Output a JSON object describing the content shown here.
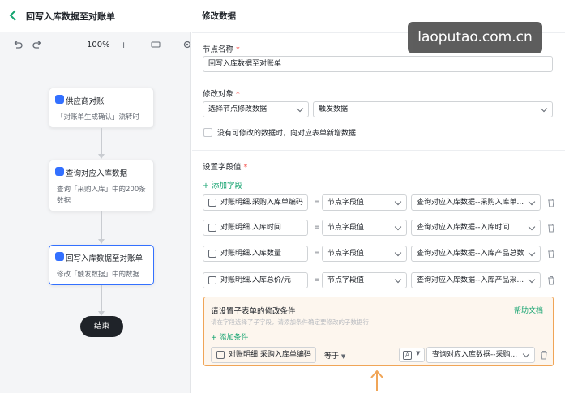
{
  "header": {
    "title": "回写入库数据至对账单"
  },
  "toolbar": {
    "zoom": "100%"
  },
  "flow": {
    "nodes": [
      {
        "title": "供应商对账",
        "desc": "「对账单生成确认」流转时"
      },
      {
        "title": "查询对应入库数据",
        "desc": "查询「采购入库」中的200条数据"
      },
      {
        "title": "回写入库数据至对账单",
        "desc": "修改「触发数据」中的数据"
      }
    ],
    "end": "结束"
  },
  "panel": {
    "title": "修改数据",
    "node_name_label": "节点名称",
    "node_name_value": "回写入库数据至对账单",
    "target_label": "修改对象",
    "target_select1": "选择节点修改数据",
    "target_select2": "触发数据",
    "checkbox_label": "没有可修改的数据时，向对应表单新增数据",
    "fields_label": "设置字段值",
    "add_field": "+ 添加字段",
    "rows": [
      {
        "field": "对账明细.采购入库单编码",
        "op": "=",
        "mode": "节点字段值",
        "value": "查询对应入库数据--采购入库单..."
      },
      {
        "field": "对账明细.入库时间",
        "op": "=",
        "mode": "节点字段值",
        "value": "查询对应入库数据--入库时间"
      },
      {
        "field": "对账明细.入库数量",
        "op": "=",
        "mode": "节点字段值",
        "value": "查询对应入库数据--入库产品总数"
      },
      {
        "field": "对账明细.入库总价/元",
        "op": "=",
        "mode": "节点字段值",
        "value": "查询对应入库数据--入库产品采..."
      }
    ],
    "condition": {
      "title": "请设置子表单的修改条件",
      "help": "帮助文档",
      "hint": "请在字段选择了子字段，请添加条件确定要修改的子数据行",
      "add": "+ 添加条件",
      "field": "对账明细.采购入库单编码",
      "op": "等于",
      "type_badge": "A",
      "value": "查询对应入库数据--采购..."
    }
  },
  "watermark": "laoputao.com.cn",
  "colors": {
    "accent": "#14a36f",
    "highlight": "#f0a557",
    "node_icon": "#3370ff"
  }
}
